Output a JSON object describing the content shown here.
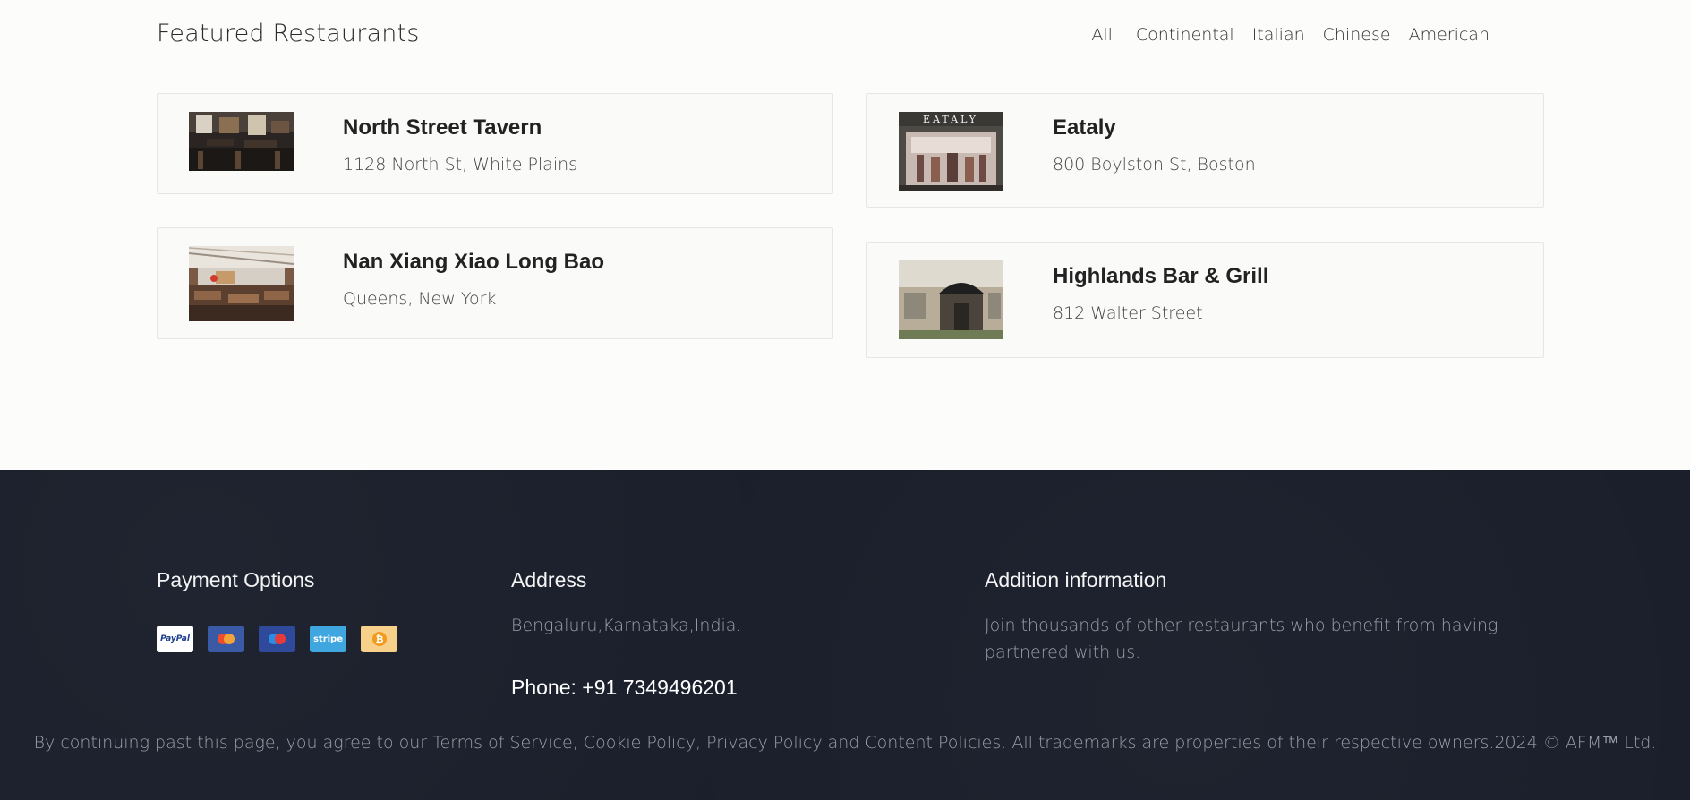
{
  "header": {
    "title": "Featured Restaurants",
    "filters": [
      "All",
      "Continental",
      "Italian",
      "Chinese",
      "American"
    ]
  },
  "restaurants": [
    {
      "name": "North Street Tavern",
      "address": "1128 North St, White Plains",
      "image": "tavern-interior"
    },
    {
      "name": "Eataly",
      "address": "800 Boylston St, Boston",
      "image": "eataly-storefront",
      "sign_text": "EATALY"
    },
    {
      "name": "Nan Xiang Xiao Long Bao",
      "address": "Queens, New York",
      "image": "dining-hall"
    },
    {
      "name": "Highlands Bar & Grill",
      "address": "812 Walter Street",
      "image": "storefront-awning"
    }
  ],
  "footer": {
    "payment_title": "Payment Options",
    "payment_methods": [
      "PayPal",
      "Mastercard",
      "Maestro",
      "stripe",
      "Bitcoin"
    ],
    "address_title": "Address",
    "address": "Bengaluru,Karnataka,India.",
    "phone": "Phone: +91 7349496201",
    "info_title": "Addition information",
    "info_text": "Join thousands of other restaurants who benefit from having partnered with us.",
    "legal_prefix": "By continuing past this page, you agree to our ",
    "legal_links": [
      "Terms of Service",
      "Cookie Policy",
      "Privacy Policy",
      "Content Policies"
    ],
    "legal_suffix": ". All trademarks are properties of their respective owners.2024 © AFM™ Ltd."
  },
  "colors": {
    "page_bg": "#fcfcfb",
    "footer_bg": "#1a1f2b",
    "card_border": "#e6e6e4"
  }
}
